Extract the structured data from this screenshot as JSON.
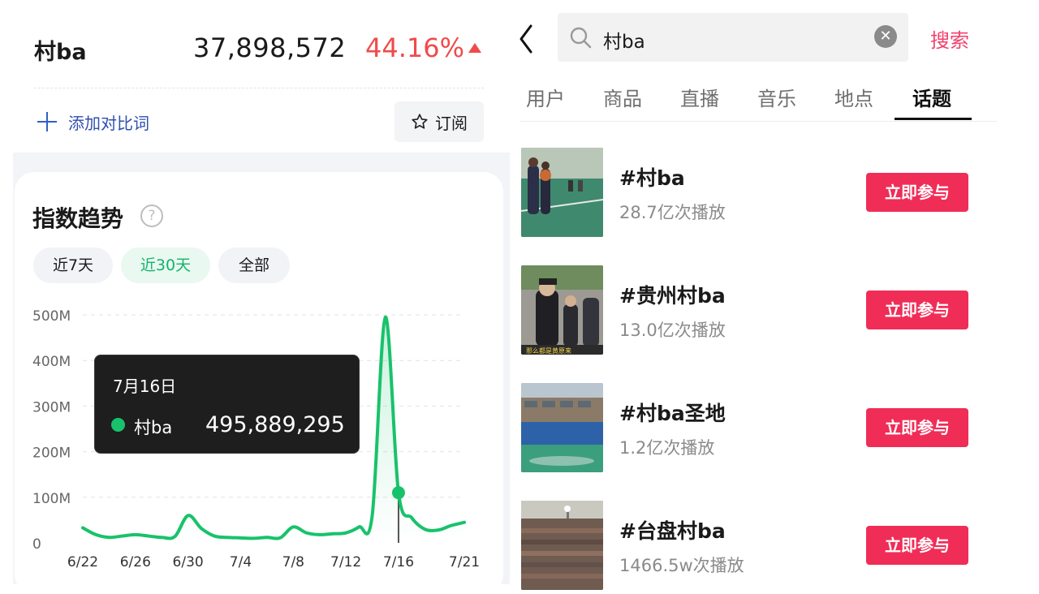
{
  "trend_panel": {
    "keyword": "村ba",
    "total": "37,898,572",
    "change_pct": "44.16%",
    "add_compare_label": "添加对比词",
    "subscribe_label": "订阅",
    "card_title": "指数趋势",
    "help_glyph": "?",
    "ranges": [
      "近7天",
      "近30天",
      "全部"
    ],
    "active_range": "近30天",
    "tooltip": {
      "date": "7月16日",
      "series_name": "村ba",
      "value": "495,889,295"
    },
    "colors": {
      "line": "#18c26b",
      "up": "#f04b4b"
    }
  },
  "chart_data": {
    "type": "line",
    "x": [
      "6/22",
      "6/23",
      "6/24",
      "6/25",
      "6/26",
      "6/27",
      "6/28",
      "6/29",
      "6/30",
      "7/1",
      "7/2",
      "7/3",
      "7/4",
      "7/5",
      "7/6",
      "7/7",
      "7/8",
      "7/9",
      "7/10",
      "7/11",
      "7/12",
      "7/13",
      "7/14",
      "7/15",
      "7/16",
      "7/17",
      "7/18",
      "7/19",
      "7/20",
      "7/21"
    ],
    "x_tick_labels": [
      "6/22",
      "6/26",
      "6/30",
      "7/4",
      "7/8",
      "7/12",
      "7/16",
      "7/21"
    ],
    "y_tick_labels": [
      "0",
      "100M",
      "200M",
      "300M",
      "400M",
      "500M"
    ],
    "ylim": [
      0,
      500
    ],
    "y_unit": "M",
    "series": [
      {
        "name": "村ba",
        "values": [
          33,
          18,
          12,
          15,
          18,
          15,
          12,
          14,
          60,
          32,
          15,
          12,
          11,
          10,
          12,
          11,
          35,
          22,
          18,
          20,
          22,
          35,
          60,
          495,
          110,
          55,
          30,
          28,
          38,
          45
        ]
      }
    ],
    "highlight": {
      "x": "7/16",
      "value": 495.889295
    },
    "grid": true
  },
  "search": {
    "query": "村ba",
    "button_label": "搜索"
  },
  "tabs": [
    "用户",
    "商品",
    "直播",
    "音乐",
    "地点",
    "话题"
  ],
  "active_tab": "话题",
  "topics": [
    {
      "name": "#村ba",
      "count": "28.7亿次播放",
      "button": "立即参与"
    },
    {
      "name": "#贵州村ba",
      "count": "13.0亿次播放",
      "button": "立即参与",
      "thumb_caption": "那么都是黄原来"
    },
    {
      "name": "#村ba圣地",
      "count": "1.2亿次播放",
      "button": "立即参与"
    },
    {
      "name": "#台盘村ba",
      "count": "1466.5w次播放",
      "button": "立即参与"
    }
  ]
}
